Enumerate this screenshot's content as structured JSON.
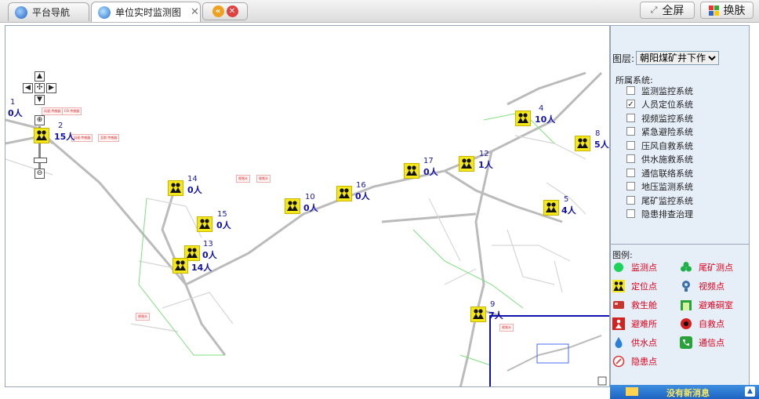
{
  "tabs": [
    {
      "label": "平台导航",
      "active": false
    },
    {
      "label": "单位实时监测图",
      "active": true
    }
  ],
  "toolbar": {
    "fullscreen_label": "全屏",
    "skin_label": "换肤"
  },
  "layer": {
    "label": "图层:",
    "selected": "朝阳煤矿井下作业"
  },
  "systems": {
    "title": "所属系统:",
    "items": [
      {
        "label": "监测监控系统",
        "checked": false
      },
      {
        "label": "人员定位系统",
        "checked": true
      },
      {
        "label": "视频监控系统",
        "checked": false
      },
      {
        "label": "紧急避险系统",
        "checked": false
      },
      {
        "label": "压风自救系统",
        "checked": false
      },
      {
        "label": "供水施救系统",
        "checked": false
      },
      {
        "label": "通信联络系统",
        "checked": false
      },
      {
        "label": "地压监测系统",
        "checked": false
      },
      {
        "label": "尾矿监控系统",
        "checked": false
      },
      {
        "label": "隐患排查治理",
        "checked": false
      }
    ]
  },
  "legend": {
    "title": "图例:",
    "items": [
      {
        "label": "监测点",
        "icon": "green-dot-icon"
      },
      {
        "label": "尾矿测点",
        "icon": "green-clover-icon"
      },
      {
        "label": "定位点",
        "icon": "people-locator-icon"
      },
      {
        "label": "视频点",
        "icon": "camera-icon"
      },
      {
        "label": "救生舱",
        "icon": "rescue-capsule-icon"
      },
      {
        "label": "避难硐室",
        "icon": "refuge-chamber-icon"
      },
      {
        "label": "避难所",
        "icon": "shelter-icon"
      },
      {
        "label": "自救点",
        "icon": "self-rescue-icon"
      },
      {
        "label": "供水点",
        "icon": "water-drop-icon"
      },
      {
        "label": "通信点",
        "icon": "phone-icon"
      },
      {
        "label": "隐患点",
        "icon": "hazard-icon"
      }
    ]
  },
  "markers": [
    {
      "id": "1",
      "count": "0人"
    },
    {
      "id": "2",
      "count": "15人"
    },
    {
      "id": "4",
      "count": "10人"
    },
    {
      "id": "5",
      "count": "4人"
    },
    {
      "id": "8",
      "count": "5人"
    },
    {
      "id": "9",
      "count": "7人"
    },
    {
      "id": "10",
      "count": "0人"
    },
    {
      "id": "12",
      "count": "1人"
    },
    {
      "id": "13",
      "count": "0人"
    },
    {
      "id": "14",
      "count": "0人"
    },
    {
      "id": "15",
      "count": "0人"
    },
    {
      "id": "16",
      "count": "0人"
    },
    {
      "id": "17",
      "count": "0人"
    },
    {
      "id": "",
      "count": "14人"
    }
  ],
  "message_bar": {
    "text": "没有新消息"
  },
  "colors": {
    "accent": "#1e63c2",
    "marker_bg": "#f5e81a",
    "legend_text": "#e2001a",
    "count_text": "#1111b0"
  }
}
